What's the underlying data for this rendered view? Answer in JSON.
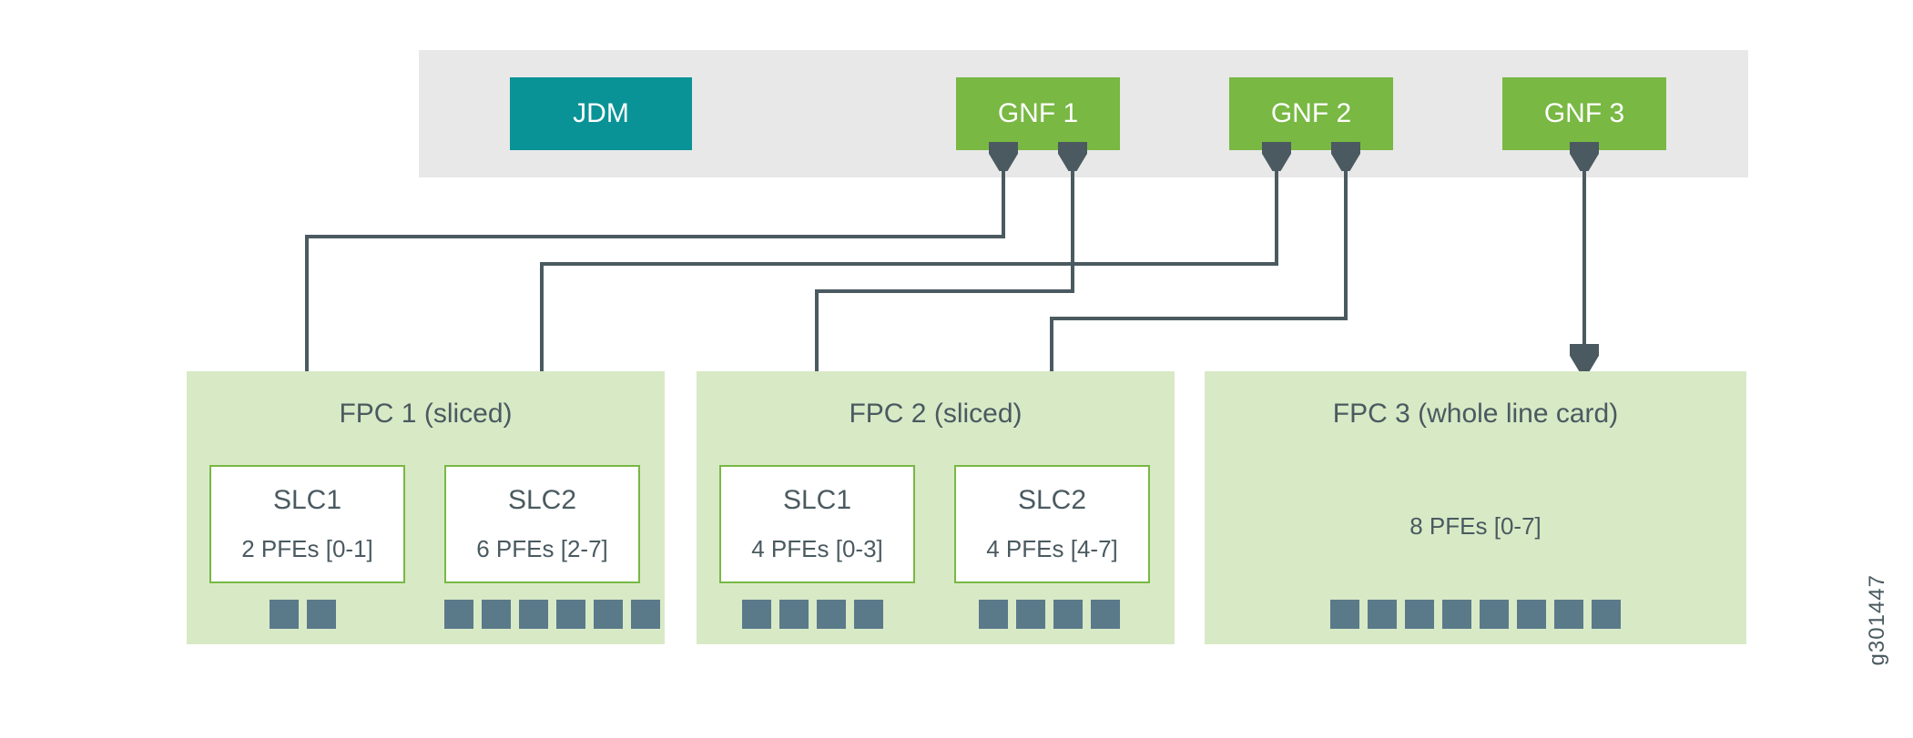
{
  "header": {
    "jdm": "JDM",
    "gnf1": "GNF 1",
    "gnf2": "GNF 2",
    "gnf3": "GNF 3"
  },
  "fpc1": {
    "title": "FPC 1 (sliced)",
    "slc1": {
      "name": "SLC1",
      "pfes": "2 PFEs [0-1]",
      "count": 2
    },
    "slc2": {
      "name": "SLC2",
      "pfes": "6 PFEs [2-7]",
      "count": 6
    }
  },
  "fpc2": {
    "title": "FPC 2 (sliced)",
    "slc1": {
      "name": "SLC1",
      "pfes": "4 PFEs [0-3]",
      "count": 4
    },
    "slc2": {
      "name": "SLC2",
      "pfes": "4 PFEs [4-7]",
      "count": 4
    }
  },
  "fpc3": {
    "title": "FPC 3 (whole line card)",
    "pfes": "8 PFEs [0-7]",
    "count": 8
  },
  "figure_number": "g301447",
  "colors": {
    "jdm": "#0a9396",
    "gnf": "#78b843",
    "fpc_bg": "#d8e9c6",
    "pfe_square": "#5a7a8a",
    "header_bg": "#e8e8e8",
    "text": "#4a5a60"
  },
  "connections": [
    {
      "from": "fpc1.slc1",
      "to": "gnf1"
    },
    {
      "from": "fpc1.slc2",
      "to": "gnf2"
    },
    {
      "from": "fpc2.slc1",
      "to": "gnf1"
    },
    {
      "from": "fpc2.slc2",
      "to": "gnf2"
    },
    {
      "from": "fpc3",
      "to": "gnf3"
    }
  ]
}
